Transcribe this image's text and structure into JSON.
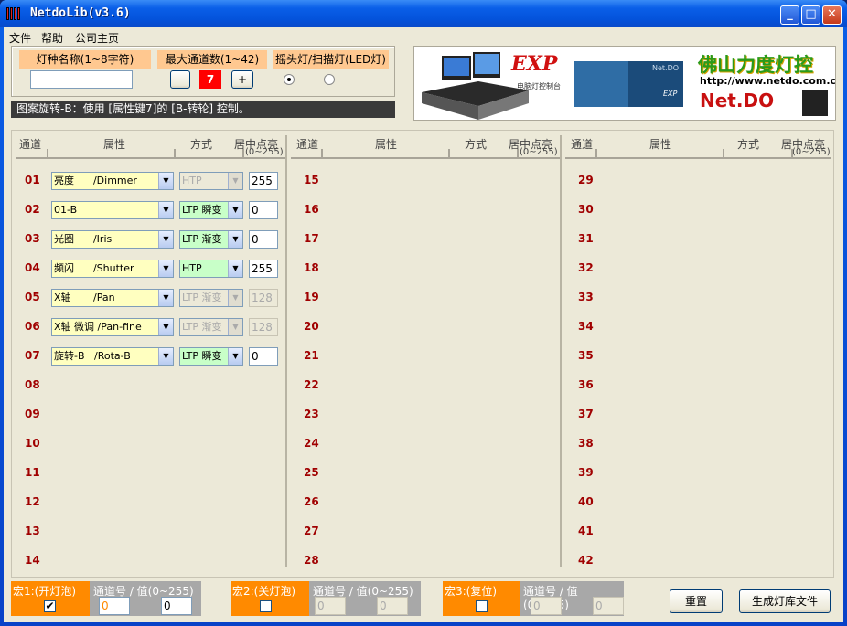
{
  "window": {
    "title": "NetdoLib(v3.6)",
    "min": "_",
    "max": "□",
    "close": "✕"
  },
  "menu": [
    "文件",
    "帮助",
    "公司主页"
  ],
  "fixture_name": {
    "label": "灯种名称(1~8字符)",
    "value": ""
  },
  "max_channels": {
    "label": "最大通道数(1~42)",
    "minus": "-",
    "value": "7",
    "plus": "+"
  },
  "fixture_type": {
    "label": "摇头灯/扫描灯(LED灯)"
  },
  "banner": {
    "exp": "EXP",
    "console_caption": "电脑灯控制台",
    "company": "佛山力度灯控",
    "url": "http://www.netdo.com.cn",
    "brand": "Net.DO",
    "mini_brand": "Net.DO",
    "mini_exp": "EXP"
  },
  "status": "图案旋转-B：使用 [属性键7]的 [B-转轮] 控制。",
  "headers": {
    "ch": "通道",
    "attr": "属性",
    "mode": "方式",
    "center": "居中点亮",
    "range": "(0~255)"
  },
  "channels": [
    {
      "n": "01",
      "attr": "亮度      /Dimmer",
      "mode": "HTP",
      "val": "255",
      "attrOn": true,
      "modeOn": false,
      "valOn": true
    },
    {
      "n": "02",
      "attr": "01-B",
      "mode": "LTP 瞬变",
      "val": "0",
      "attrOn": true,
      "modeOn": true,
      "valOn": true
    },
    {
      "n": "03",
      "attr": "光圈      /Iris",
      "mode": "LTP 渐变",
      "val": "0",
      "attrOn": true,
      "modeOn": true,
      "valOn": true
    },
    {
      "n": "04",
      "attr": "频闪      /Shutter",
      "mode": "HTP",
      "val": "255",
      "attrOn": true,
      "modeOn": true,
      "valOn": true
    },
    {
      "n": "05",
      "attr": "X轴       /Pan",
      "mode": "LTP 渐变",
      "val": "128",
      "attrOn": true,
      "modeOn": false,
      "valOn": false
    },
    {
      "n": "06",
      "attr": "X轴 微调 /Pan-fine",
      "mode": "LTP 渐变",
      "val": "128",
      "attrOn": true,
      "modeOn": false,
      "valOn": false
    },
    {
      "n": "07",
      "attr": "旋转-B   /Rota-B",
      "mode": "LTP 瞬变",
      "val": "0",
      "attrOn": true,
      "modeOn": true,
      "valOn": true
    },
    {
      "n": "08"
    },
    {
      "n": "09"
    },
    {
      "n": "10"
    },
    {
      "n": "11"
    },
    {
      "n": "12"
    },
    {
      "n": "13"
    },
    {
      "n": "14"
    }
  ],
  "col2": [
    "15",
    "16",
    "17",
    "18",
    "19",
    "20",
    "21",
    "22",
    "23",
    "24",
    "25",
    "26",
    "27",
    "28"
  ],
  "col3": [
    "29",
    "30",
    "31",
    "32",
    "33",
    "34",
    "35",
    "36",
    "37",
    "38",
    "39",
    "40",
    "41",
    "42"
  ],
  "macros": [
    {
      "label": "宏1:(开灯泡)",
      "checked": "✔",
      "sub": "通道号 / 值(0~255)",
      "ch": "0",
      "val": "0",
      "enabled": true
    },
    {
      "label": "宏2:(关灯泡)",
      "checked": "",
      "sub": "通道号 / 值(0~255)",
      "ch": "0",
      "val": "0",
      "enabled": false
    },
    {
      "label": "宏3:(复位)",
      "checked": "",
      "sub": "通道号 / 值(0~255)",
      "ch": "0",
      "val": "0",
      "enabled": false
    }
  ],
  "buttons": {
    "reset": "重置",
    "generate": "生成灯库文件"
  },
  "colors": {
    "attr_bg": "#ffffc0",
    "mode_bg": "#c8ffc8",
    "orange": "#ff8a00",
    "red_channel": "#a00000"
  }
}
